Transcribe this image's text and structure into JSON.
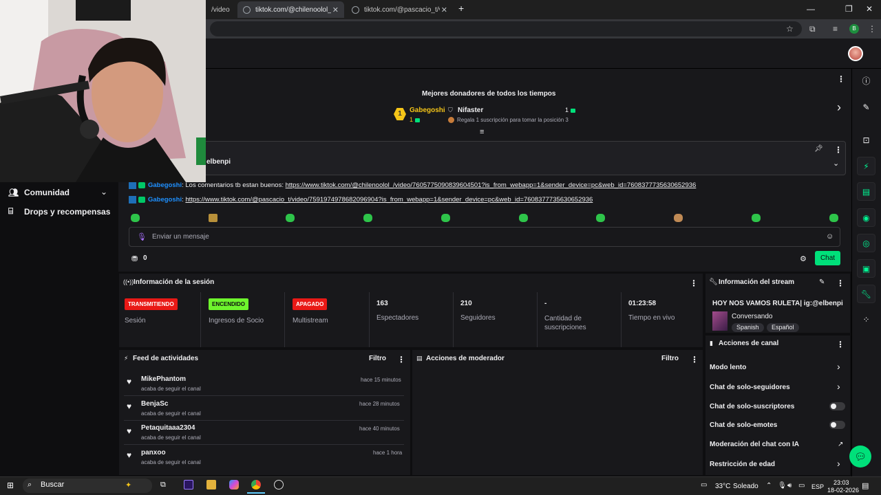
{
  "browser": {
    "tabs": [
      {
        "label": "/video"
      },
      {
        "label": "tiktok.com/@chilenoolol_/video/"
      },
      {
        "label": "tiktok.com/@pascacio_t/video/"
      }
    ],
    "new_tab": "+",
    "profile_initial": "B"
  },
  "sidebar": {
    "items": [
      {
        "label": "Comunidad",
        "icon": "people-icon"
      },
      {
        "label": "Drops y recompensas",
        "icon": "gift-icon"
      }
    ]
  },
  "donors": {
    "title": "Mejores donadores de todos los tiempos",
    "first": {
      "rank": "1",
      "name": "Gabegoshi",
      "subs": "1"
    },
    "second": {
      "name": "Nifaster",
      "subs": "1",
      "note": "Regala 1 suscripción para tomar la posición 3"
    }
  },
  "pinned": {
    "text": "elbenpi"
  },
  "chat": {
    "messages": [
      {
        "user": "Gabegoshi",
        "text": ": Los comentarios tb estan buenos: ",
        "link": "https://www.tiktok.com/@chilenoolol_/video/7605775090839604501?is_from_webapp=1&sender_device=pc&web_id=7608377735630652936"
      },
      {
        "user": "Gabegoshi",
        "text": ": ",
        "link": "https://www.tiktok.com/@pascacio_t/video/7591974978682096904?is_from_webapp=1&sender_device=pc&web_id=7608377735630652936"
      }
    ],
    "placeholder": "Enviar un mensaje",
    "points": "0",
    "send_label": "Chat"
  },
  "session": {
    "title": "Información de la sesión",
    "stats": [
      {
        "tag": "TRANSMITIENDO",
        "label": "Sesión"
      },
      {
        "tag": "ENCENDIDO",
        "label": "Ingresos de Socio"
      },
      {
        "tag": "APAGADO",
        "label": "Multistream"
      },
      {
        "value": "163",
        "label": "Espectadores"
      },
      {
        "value": "210",
        "label": "Seguidores"
      },
      {
        "value": "-",
        "label": "Cantidad de suscripciones"
      },
      {
        "value": "01:23:58",
        "label": "Tiempo en vivo"
      }
    ],
    "colors": {
      "live": "#e91916",
      "on": "#6ef52d",
      "off": "#e91916"
    }
  },
  "stream_info": {
    "title": "Información del stream",
    "stream_title": "HOY NOS VAMOS RULETA| ig:@elbenpi",
    "category": "Conversando",
    "tags": [
      "Spanish",
      "Español"
    ]
  },
  "feed": {
    "title": "Feed de actividades",
    "filter": "Filtro",
    "items": [
      {
        "name": "MikePhantom",
        "action": "acaba de seguir el canal",
        "time": "hace 15 minutos"
      },
      {
        "name": "BenjaSc",
        "action": "acaba de seguir el canal",
        "time": "hace 28 minutos"
      },
      {
        "name": "Petaquitaaa2304",
        "action": "acaba de seguir el canal",
        "time": "hace 40 minutos"
      },
      {
        "name": "panxoo",
        "action": "acaba de seguir el canal",
        "time": "hace 1 hora"
      }
    ]
  },
  "mod_actions": {
    "title": "Acciones de moderador",
    "filter": "Filtro"
  },
  "channel_actions": {
    "title": "Acciones de canal",
    "items": [
      {
        "label": "Modo lento",
        "control": "chevron"
      },
      {
        "label": "Chat de solo-seguidores",
        "control": "chevron"
      },
      {
        "label": "Chat de solo-suscriptores",
        "control": "toggle",
        "on": false
      },
      {
        "label": "Chat de solo-emotes",
        "control": "toggle",
        "on": false
      },
      {
        "label": "Moderación del chat con IA",
        "control": "external"
      },
      {
        "label": "Restricción de edad",
        "control": "chevron"
      }
    ]
  },
  "taskbar": {
    "search": "Buscar",
    "weather": "33°C",
    "weather_desc": "Soleado",
    "lang": "ESP",
    "time": "23:03",
    "date": "18-02-2026"
  },
  "accent": "#00e07a"
}
